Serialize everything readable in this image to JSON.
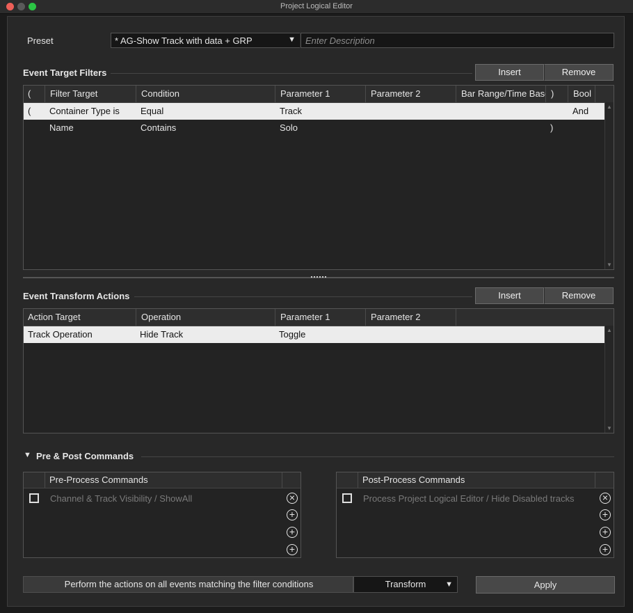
{
  "window": {
    "title": "Project Logical Editor"
  },
  "preset": {
    "label": "Preset",
    "selected": "* AG-Show Track with data + GRP",
    "description_placeholder": "Enter Description"
  },
  "filters": {
    "title": "Event Target Filters",
    "insert_label": "Insert",
    "remove_label": "Remove",
    "columns": [
      "(",
      "Filter Target",
      "Condition",
      "Parameter 1",
      "Parameter 2",
      "Bar Range/Time Base",
      ")",
      "Bool"
    ],
    "rows": [
      {
        "open": "(",
        "target": "Container Type is",
        "condition": "Equal",
        "param1": "Track",
        "param2": "",
        "range": "",
        "close": "",
        "bool": "And"
      },
      {
        "open": "",
        "target": "Name",
        "condition": "Contains",
        "param1": "Solo",
        "param2": "",
        "range": "",
        "close": ")",
        "bool": ""
      }
    ]
  },
  "actions": {
    "title": "Event Transform Actions",
    "insert_label": "Insert",
    "remove_label": "Remove",
    "columns": [
      "Action Target",
      "Operation",
      "Parameter 1",
      "Parameter 2"
    ],
    "rows": [
      {
        "target": "Track Operation",
        "operation": "Hide Track",
        "param1": "Toggle",
        "param2": ""
      }
    ]
  },
  "commands": {
    "title": "Pre & Post Commands",
    "pre": {
      "header": "Pre-Process Commands",
      "item": "Channel & Track Visibility / ShowAll"
    },
    "post": {
      "header": "Post-Process Commands",
      "item": "Process Project Logical Editor / Hide Disabled tracks"
    }
  },
  "footer": {
    "description": "Perform the actions on all events matching the filter conditions",
    "mode": "Transform",
    "apply_label": "Apply"
  },
  "colors": {
    "selected_row": "#ececec",
    "panel": "#282828",
    "button": "#484848"
  }
}
